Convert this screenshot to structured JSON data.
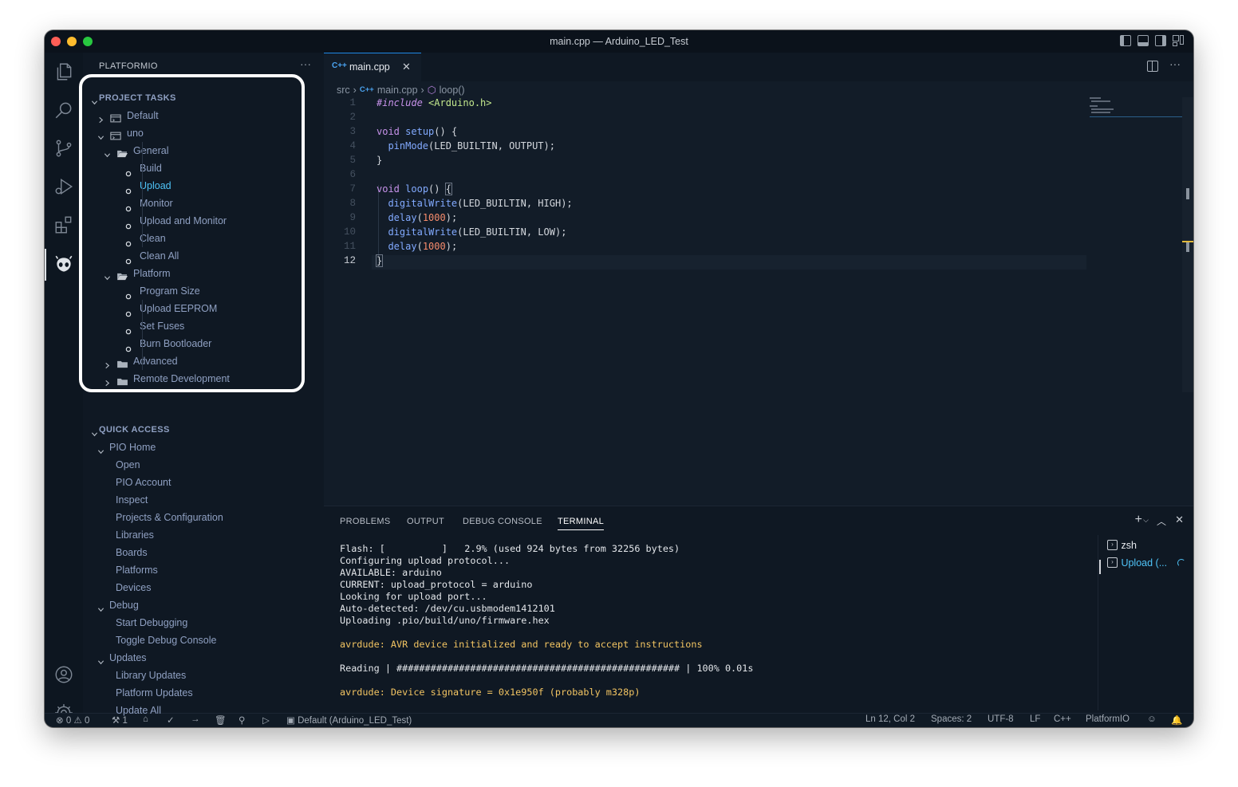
{
  "window": {
    "title": "main.cpp — Arduino_LED_Test"
  },
  "sidebar": {
    "header": "PLATFORMIO",
    "more": "···",
    "project_tasks": {
      "label": "PROJECT TASKS",
      "default_env": "Default",
      "uno_env": "uno",
      "general": {
        "label": "General",
        "items": [
          "Build",
          "Upload",
          "Monitor",
          "Upload and Monitor",
          "Clean",
          "Clean All"
        ]
      },
      "platform": {
        "label": "Platform",
        "items": [
          "Program Size",
          "Upload EEPROM",
          "Set Fuses",
          "Burn Bootloader"
        ]
      },
      "advanced": "Advanced",
      "remote": "Remote Development"
    },
    "quick_access": {
      "label": "QUICK ACCESS",
      "pio_home": {
        "label": "PIO Home",
        "items": [
          "Open",
          "PIO Account",
          "Inspect",
          "Projects & Configuration",
          "Libraries",
          "Boards",
          "Platforms",
          "Devices"
        ]
      },
      "debug": {
        "label": "Debug",
        "items": [
          "Start Debugging",
          "Toggle Debug Console"
        ]
      },
      "updates": {
        "label": "Updates",
        "items": [
          "Library Updates",
          "Platform Updates",
          "Update All"
        ]
      }
    }
  },
  "editor": {
    "tab": {
      "lang": "C++",
      "label": "main.cpp",
      "close": "✕"
    },
    "breadcrumb": [
      "src",
      "main.cpp",
      "loop()"
    ],
    "lines": [
      "1",
      "2",
      "3",
      "4",
      "5",
      "6",
      "7",
      "8",
      "9",
      "10",
      "11",
      "12"
    ]
  },
  "panel": {
    "tabs": [
      "PROBLEMS",
      "OUTPUT",
      "DEBUG CONSOLE",
      "TERMINAL"
    ],
    "active_tab": "TERMINAL",
    "terminals": [
      "zsh",
      "Upload (..."
    ],
    "terminal_lines": [
      "Flash: [          ]   2.9% (used 924 bytes from 32256 bytes)",
      "Configuring upload protocol...",
      "AVAILABLE: arduino",
      "CURRENT: upload_protocol = arduino",
      "Looking for upload port...",
      "Auto-detected: /dev/cu.usbmodem1412101",
      "Uploading .pio/build/uno/firmware.hex",
      "avrdude: AVR device initialized and ready to accept instructions",
      "Reading | ################################################## | 100% 0.01s",
      "avrdude: Device signature = 0x1e950f (probably m328p)"
    ]
  },
  "statusbar": {
    "errors": "0",
    "warnings": "0",
    "remote_count": "1",
    "env": "Default (Arduino_LED_Test)",
    "position": "Ln 12, Col 2",
    "spaces": "Spaces: 2",
    "encoding": "UTF-8",
    "eol": "LF",
    "language": "C++",
    "platformio": "PlatformIO"
  },
  "colors": {
    "accent": "#1e88e5",
    "highlight_item": "#4fc3f7",
    "terminal_warning": "#f2c462",
    "window_bg": "#101a25"
  }
}
